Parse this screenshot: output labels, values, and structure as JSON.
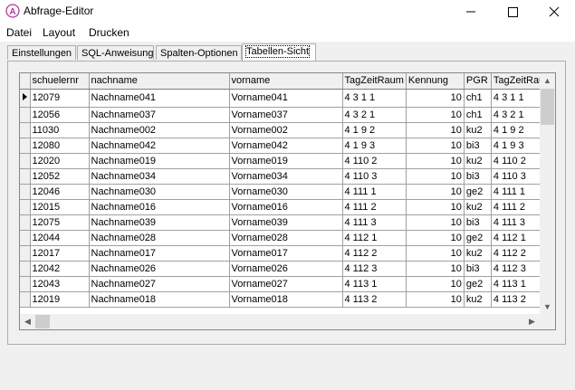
{
  "window": {
    "title": "Abfrage-Editor"
  },
  "menu": [
    "Datei",
    "Layout",
    "Drucken"
  ],
  "tabs": [
    "Einstellungen",
    "SQL-Anweisung",
    "Spalten-Optionen",
    "Tabellen-Sicht"
  ],
  "active_tab": "Tabellen-Sicht",
  "columns": [
    "schuelernr",
    "nachname",
    "vorname",
    "TagZeitRaum",
    "Kennung",
    "PGR",
    "TagZeitRau"
  ],
  "rows": [
    [
      "12079",
      "Nachname041",
      "Vorname041",
      "4 3 1 1",
      "10",
      "ch1",
      "4 3 1 1"
    ],
    [
      "12056",
      "Nachname037",
      "Vorname037",
      "4 3 2 1",
      "10",
      "ch1",
      "4 3 2 1"
    ],
    [
      "11030",
      "Nachname002",
      "Vorname002",
      "4 1 9 2",
      "10",
      "ku2",
      "4 1 9 2"
    ],
    [
      "12080",
      "Nachname042",
      "Vorname042",
      "4 1 9 3",
      "10",
      "bi3",
      "4 1 9 3"
    ],
    [
      "12020",
      "Nachname019",
      "Vorname019",
      "4 110 2",
      "10",
      "ku2",
      "4 110 2"
    ],
    [
      "12052",
      "Nachname034",
      "Vorname034",
      "4 110 3",
      "10",
      "bi3",
      "4 110 3"
    ],
    [
      "12046",
      "Nachname030",
      "Vorname030",
      "4 111 1",
      "10",
      "ge2",
      "4 111 1"
    ],
    [
      "12015",
      "Nachname016",
      "Vorname016",
      "4 111 2",
      "10",
      "ku2",
      "4 111 2"
    ],
    [
      "12075",
      "Nachname039",
      "Vorname039",
      "4 111 3",
      "10",
      "bi3",
      "4 111 3"
    ],
    [
      "12044",
      "Nachname028",
      "Vorname028",
      "4 112 1",
      "10",
      "ge2",
      "4 112 1"
    ],
    [
      "12017",
      "Nachname017",
      "Vorname017",
      "4 112 2",
      "10",
      "ku2",
      "4 112 2"
    ],
    [
      "12042",
      "Nachname026",
      "Vorname026",
      "4 112 3",
      "10",
      "bi3",
      "4 112 3"
    ],
    [
      "12043",
      "Nachname027",
      "Vorname027",
      "4 113 1",
      "10",
      "ge2",
      "4 113 1"
    ],
    [
      "12019",
      "Nachname018",
      "Vorname018",
      "4 113 2",
      "10",
      "ku2",
      "4 113 2"
    ]
  ],
  "icons": {
    "app": "app-logo-icon",
    "minimize": "minimize-icon",
    "maximize": "maximize-icon",
    "close": "close-icon",
    "row_indicator": "current-row-pointer-icon",
    "scroll_up": "scroll-up-arrow-icon",
    "scroll_down": "scroll-down-arrow-icon",
    "scroll_left": "scroll-left-arrow-icon",
    "scroll_right": "scroll-right-arrow-icon"
  },
  "colors": {
    "app_icon": "#b23a9a",
    "window_bg": "#f0f0f0",
    "grid_bg": "#ffffff"
  }
}
